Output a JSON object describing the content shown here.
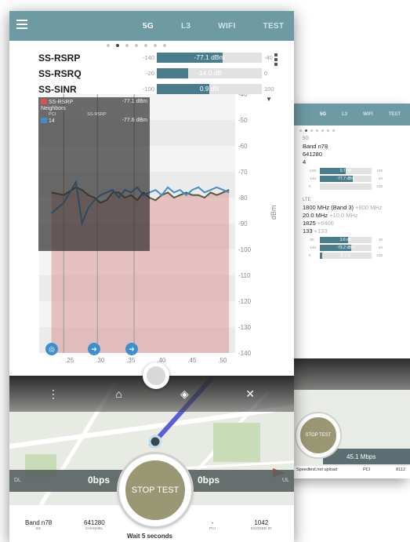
{
  "main": {
    "tabs": [
      {
        "label": "5G",
        "active": true
      },
      {
        "label": "L3",
        "active": false
      },
      {
        "label": "WIFI",
        "active": false
      },
      {
        "label": "TEST",
        "active": false
      }
    ],
    "page_count": 7,
    "page_active": 1,
    "metrics": [
      {
        "name": "SS-RSRP",
        "min": "-140",
        "value": "-77.1 dBm",
        "max": "-40",
        "fill": 0.63
      },
      {
        "name": "SS-RSRQ",
        "min": "-20",
        "value": "-14.0 dB",
        "max": "0",
        "fill": 0.3
      },
      {
        "name": "SS-SINR",
        "min": "-100",
        "value": "0.9 dB",
        "max": "100",
        "fill": 0.5
      }
    ],
    "legend": {
      "serving_label": "SS-RSRP",
      "serving_value": "-77.1 dBm",
      "neighbors_label": "Neighbors",
      "col_pci": "PCI",
      "col_rsrp": "SS-RSRP",
      "neighbor_pci": "14",
      "neighbor_value": "-77.6 dBm",
      "serving_color": "#d9534f",
      "neighbor_color": "#3f8fd0"
    },
    "nav_icons": [
      "target-icon",
      "arrow-right-icon",
      "arrow-right-icon"
    ],
    "map": {
      "toolbar_icons": [
        "more-vert-icon",
        "home-icon",
        "layers-icon",
        "collapse-icon"
      ],
      "dl_label": "DL",
      "dl_value": "0bps",
      "ul_label": "UL",
      "ul_value": "0bps",
      "stop_label": "STOP TEST"
    },
    "footer": {
      "band": "Band n78",
      "band_sub": "5G",
      "channel": "641280",
      "channel_sub": "CHANNEL",
      "pci": "-",
      "pci_sub": "PCI",
      "enodeb": "1042",
      "enodeb_sub": "ENODEB ID",
      "wait": "Wait 5 seconds"
    }
  },
  "chart_data": {
    "type": "line",
    "ylabel": "dBm",
    "ylim": [
      -140,
      -40
    ],
    "y_ticks": [
      "-40",
      "-50",
      "-60",
      "-70",
      "-80",
      "-90",
      "-100",
      "-110",
      "-120",
      "-130",
      "-140"
    ],
    "x_ticks": [
      ".25",
      ".30",
      ".35",
      ".40",
      ".45",
      ".50"
    ],
    "x": [
      0.22,
      0.24,
      0.26,
      0.27,
      0.28,
      0.29,
      0.3,
      0.31,
      0.32,
      0.33,
      0.34,
      0.35,
      0.36,
      0.37,
      0.38,
      0.39,
      0.4,
      0.41,
      0.42,
      0.43,
      0.44,
      0.45,
      0.46,
      0.47,
      0.48,
      0.49,
      0.5,
      0.51
    ],
    "series": [
      {
        "name": "SS-RSRP",
        "values": [
          -78,
          -79,
          -76,
          -77,
          -79,
          -80,
          -82,
          -81,
          -78,
          -78,
          -80,
          -79,
          -81,
          -78,
          -80,
          -81,
          -79,
          -78,
          -80,
          -79,
          -78,
          -79,
          -79,
          -80,
          -78,
          -79,
          -78,
          -77
        ]
      },
      {
        "name": "PCI 14",
        "values": [
          -86,
          -82,
          -74,
          -90,
          -84,
          -81,
          -79,
          -78,
          -77,
          -80,
          -77,
          -78,
          -76,
          -79,
          -78,
          -77,
          -79,
          -76,
          -78,
          -77,
          -79,
          -77,
          -76,
          -78,
          -77,
          -76,
          -77,
          -78
        ]
      }
    ]
  },
  "back_phone": {
    "tabs": [
      "5G",
      "L3",
      "WIFI",
      "TEST"
    ],
    "nr_header": "5G",
    "nr_band": "Band n78",
    "nr_channel": "641280",
    "nr_pci": "4",
    "nr_bars": [
      {
        "lo": "-100",
        "value": "0.7 dB",
        "hi": "100",
        "fill": 0.5
      },
      {
        "lo": "-140",
        "value": "-77.7 dBm",
        "hi": "-40",
        "fill": 0.63
      },
      {
        "lo": "0",
        "value": "",
        "hi": "100",
        "fill": 0.0
      }
    ],
    "lte_header": "LTE",
    "lte_band": "1800 MHz (Band 3)",
    "lte_band_alt": "+800 MHz",
    "lte_bw": "20.0 MHz",
    "lte_bw_alt": "+10.0 MHz",
    "lte_earfcn": "1825",
    "lte_earfcn_alt": "+6400",
    "lte_pci": "133",
    "lte_pci_alt": "+133",
    "lte_bars": [
      {
        "lo": "-20",
        "value": "3.6 dB",
        "hi": "30",
        "fill": 0.55
      },
      {
        "lo": "-140",
        "value": "-79.2 dBm",
        "hi": "-40",
        "fill": 0.61
      },
      {
        "lo": "0",
        "value": "5.1 %",
        "hi": "100",
        "fill": 0.05
      }
    ],
    "stop_label": "STOP TEST",
    "speed": "45.1 Mbps",
    "foot_left": "Speedtest.net upload",
    "foot_pci": "PCI",
    "foot_enb": "8112"
  }
}
